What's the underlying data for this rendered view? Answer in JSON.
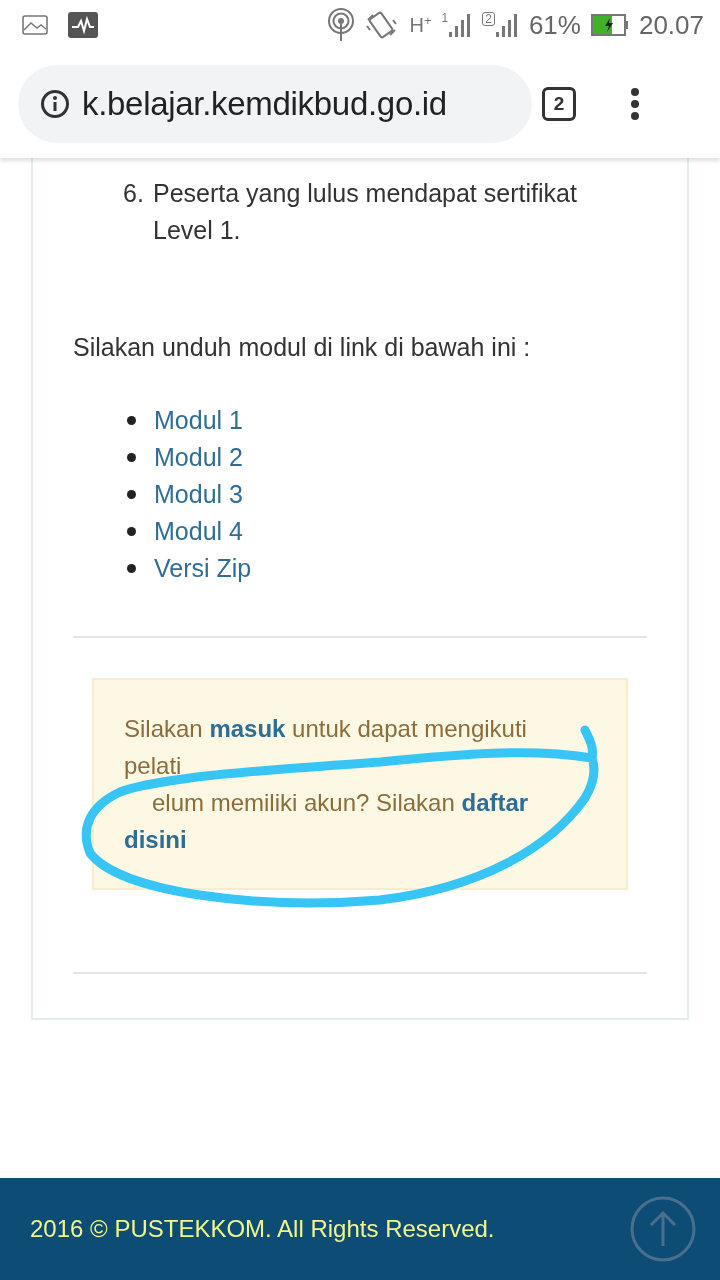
{
  "status_bar": {
    "network": "H",
    "network_plus": "+",
    "sim_1": "1",
    "sim_2": "2",
    "battery_percent": "61%",
    "time": "20.07"
  },
  "browser": {
    "url": "k.belajar.kemdikbud.go.id",
    "tab_count": "2"
  },
  "steps": [
    {
      "number": "6.",
      "text": "Peserta yang lulus mendapat sertifikat Level 1."
    }
  ],
  "download_intro": "Silakan unduh modul di link di bawah ini :",
  "modules": [
    "Modul 1",
    "Modul 2",
    "Modul 3",
    "Modul 4",
    "Versi Zip"
  ],
  "alert": {
    "lines": [
      [
        {
          "kind": "text",
          "text": "Silakan "
        },
        {
          "kind": "link",
          "text": "masuk"
        },
        {
          "kind": "text",
          "text": " untuk dapat mengikuti"
        }
      ],
      [
        {
          "kind": "text",
          "text": "pelati"
        }
      ],
      [
        {
          "kind": "text",
          "text": "elum memiliki akun? Silakan "
        },
        {
          "kind": "link",
          "text": "daftar"
        }
      ],
      [
        {
          "kind": "link",
          "text": "disini"
        }
      ]
    ]
  },
  "footer": {
    "copyright": "2016 © PUSTEKKOM. All Rights Reserved."
  }
}
